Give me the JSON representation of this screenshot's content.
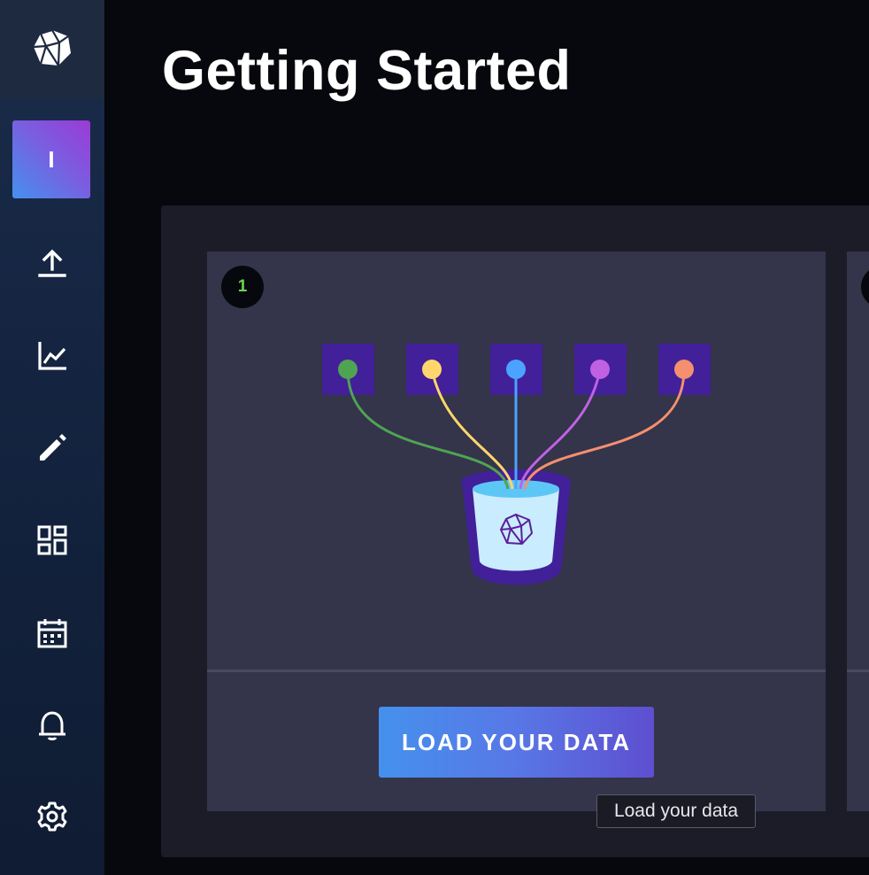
{
  "page": {
    "title": "Getting Started"
  },
  "sidebar": {
    "logo_icon": "influx-cuboid-logo-icon",
    "org_initial": "I",
    "items": [
      {
        "name": "load-data",
        "icon": "upload-icon"
      },
      {
        "name": "data-explorer",
        "icon": "line-chart-icon"
      },
      {
        "name": "notebooks",
        "icon": "pencil-icon"
      },
      {
        "name": "dashboards",
        "icon": "dashboard-grid-icon"
      },
      {
        "name": "tasks",
        "icon": "calendar-icon"
      },
      {
        "name": "alerts",
        "icon": "bell-icon"
      },
      {
        "name": "settings",
        "icon": "gear-icon"
      }
    ]
  },
  "steps": [
    {
      "number": "1",
      "button_label": "LOAD YOUR DATA",
      "illustration": "data-sources-into-bucket",
      "source_colors": [
        "#4fa453",
        "#ffd66b",
        "#4ba3ff",
        "#c061e4",
        "#f48f6f"
      ]
    }
  ],
  "tooltip": {
    "text": "Load your data"
  },
  "colors": {
    "background": "#07070e",
    "panel": "#1c1c28",
    "card": "#34344a",
    "accent_blue": "#4591ed",
    "accent_purple": "#5e4fd0",
    "badge_green": "#67d74e"
  }
}
